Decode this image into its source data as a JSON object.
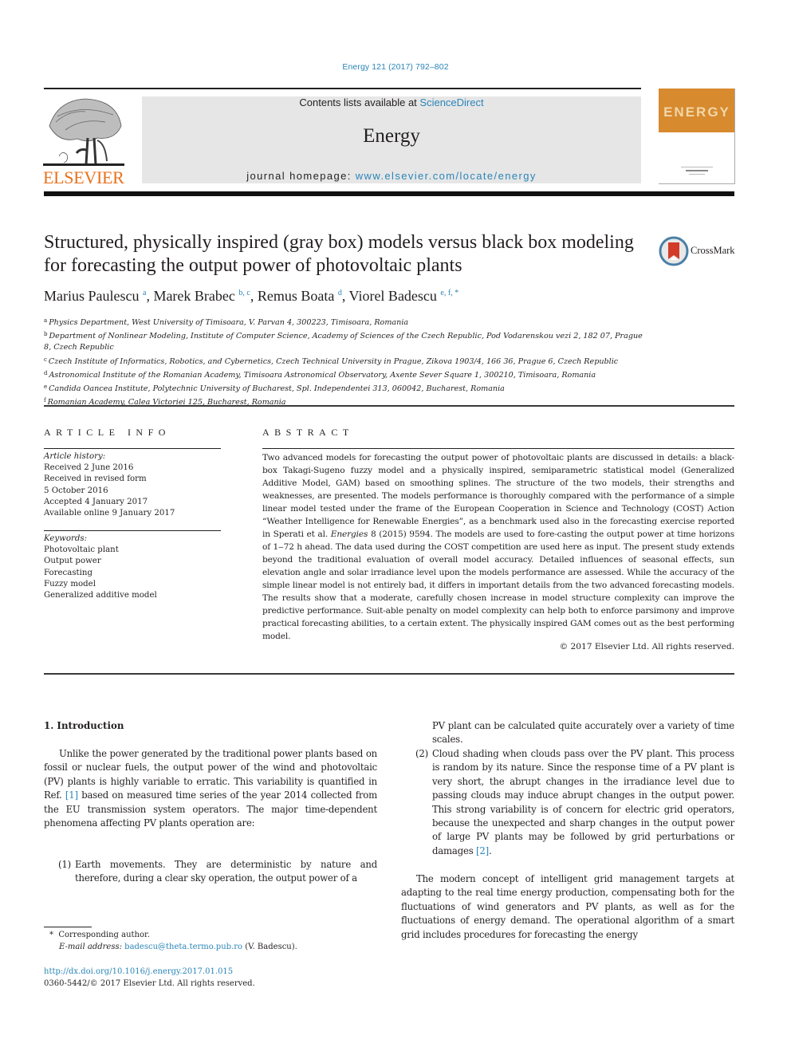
{
  "running_head": "Energy 121 (2017) 792–802",
  "masthead": {
    "contents_prefix": "Contents lists available at ",
    "contents_link": "ScienceDirect",
    "journal_name": "Energy",
    "homepage_prefix": "journal homepage: ",
    "homepage_link": "www.elsevier.com/locate/energy",
    "publisher_logo_text": "ELSEVIER",
    "cover_title": "ENERGY"
  },
  "colors": {
    "link": "#2a85b8",
    "elsevier_orange": "#e9711c",
    "masthead_gray": "#e6e6e6",
    "cover_orange": "#d78a2e"
  },
  "article": {
    "title": "Structured, physically inspired (gray box) models versus black box modeling for forecasting the output power of photovoltaic plants",
    "crossmark_label": "CrossMark",
    "authors": [
      {
        "name": "Marius Paulescu",
        "sup": "a"
      },
      {
        "name": "Marek Brabec",
        "sup": "b, c"
      },
      {
        "name": "Remus Boata",
        "sup": "d"
      },
      {
        "name": "Viorel Badescu",
        "sup": "e, f, *"
      }
    ],
    "affiliations": [
      {
        "key": "a",
        "text": "Physics Department, West University of Timisoara, V. Parvan 4, 300223, Timisoara, Romania"
      },
      {
        "key": "b",
        "text": "Department of Nonlinear Modeling, Institute of Computer Science, Academy of Sciences of the Czech Republic, Pod Vodarenskou vezi 2, 182 07, Prague 8, Czech Republic"
      },
      {
        "key": "c",
        "text": "Czech Institute of Informatics, Robotics, and Cybernetics, Czech Technical University in Prague, Zikova 1903/4, 166 36, Prague 6, Czech Republic"
      },
      {
        "key": "d",
        "text": "Astronomical Institute of the Romanian Academy, Timisoara Astronomical Observatory, Axente Sever Square 1, 300210, Timisoara, Romania"
      },
      {
        "key": "e",
        "text": "Candida Oancea Institute, Polytechnic University of Bucharest, Spl. Independentei 313, 060042, Bucharest, Romania"
      },
      {
        "key": "f",
        "text": "Romanian Academy, Calea Victoriei 125, Bucharest, Romania"
      }
    ]
  },
  "article_info": {
    "heading": "ARTICLE INFO",
    "history_label": "Article history:",
    "history": [
      "Received 2 June 2016",
      "Received in revised form",
      "5 October 2016",
      "Accepted 4 January 2017",
      "Available online 9 January 2017"
    ],
    "keywords_label": "Keywords:",
    "keywords": [
      "Photovoltaic plant",
      "Output power",
      "Forecasting",
      "Fuzzy model",
      "Generalized additive model"
    ]
  },
  "abstract": {
    "heading": "ABSTRACT",
    "text_before_journal": "Two advanced models for forecasting the output power of photovoltaic plants are discussed in details: a black-box Takagi-Sugeno fuzzy model and a physically inspired, semiparametric statistical model (Generalized Additive Model, GAM) based on smoothing splines. The structure of the two models, their strengths and weaknesses, are presented. The models performance is thoroughly compared with the performance of a simple linear model tested under the frame of the European Cooperation in Science and Technology (COST) Action “Weather Intelligence for Renewable Energies”, as a benchmark used also in the forecasting exercise reported in Sperati et al. ",
    "journal_ref": "Energies",
    "text_after_journal": " 8 (2015) 9594. The models are used to fore-casting the output power at time horizons of 1‒72 h ahead. The data used during the COST competition are used here as input. The present study extends beyond the traditional evaluation of overall model accuracy. Detailed influences of seasonal effects, sun elevation angle and solar irradiance level upon the models performance are assessed. While the accuracy of the simple linear model is not entirely bad, it differs in important details from the two advanced forecasting models. The results show that a moderate, carefully chosen increase in model structure complexity can improve the predictive performance. Suit-able penalty on model complexity can help both to enforce parsimony and improve practical forecasting abilities, to a certain extent. The physically inspired GAM comes out as the best performing model.",
    "copyright": "© 2017 Elsevier Ltd. All rights reserved."
  },
  "body": {
    "section_heading": "1.  Introduction",
    "intro_before_ref": "Unlike the power generated by the traditional power plants based on fossil or nuclear fuels, the output power of the wind and photovoltaic (PV) plants is highly variable to erratic. This variability is quantified in Ref. ",
    "intro_ref": "[1]",
    "intro_after_ref": " based on measured time series of the year 2014 collected from the EU transmission system operators. The major time-dependent phenomena affecting PV plants operation are:",
    "list": [
      {
        "num": "(1)",
        "text_left": "Earth movements. They are deterministic by nature and therefore, during a clear sky operation, the output power of a",
        "text_right": "PV plant can be calculated quite accurately over a variety of time scales."
      },
      {
        "num": "(2)",
        "text": "Cloud shading when clouds pass over the PV plant. This process is random by its nature. Since the response time of a PV plant is very short, the abrupt changes in the irradiance level due to passing clouds may induce abrupt changes in the output power. This strong variability is of concern for electric grid operators, because the unexpected and sharp changes in the output power of large PV plants may be followed by grid perturbations or damages ",
        "ref": "[2]",
        "after_ref": "."
      }
    ],
    "right_para": "The modern concept of intelligent grid management targets at adapting to the real time energy production, compensating both for the fluctuations of wind generators and PV plants, as well as for the fluctuations of energy demand. The operational algorithm of a smart grid includes procedures for forecasting the energy"
  },
  "footnotes": {
    "corresponding_mark": "*",
    "corresponding_text": "Corresponding author.",
    "email_label": "E-mail address:",
    "email": "badescu@theta.termo.pub.ro",
    "email_owner": "(V. Badescu)."
  },
  "doi": {
    "url": "http://dx.doi.org/10.1016/j.energy.2017.01.015",
    "issn_line": "0360-5442/© 2017 Elsevier Ltd. All rights reserved."
  }
}
